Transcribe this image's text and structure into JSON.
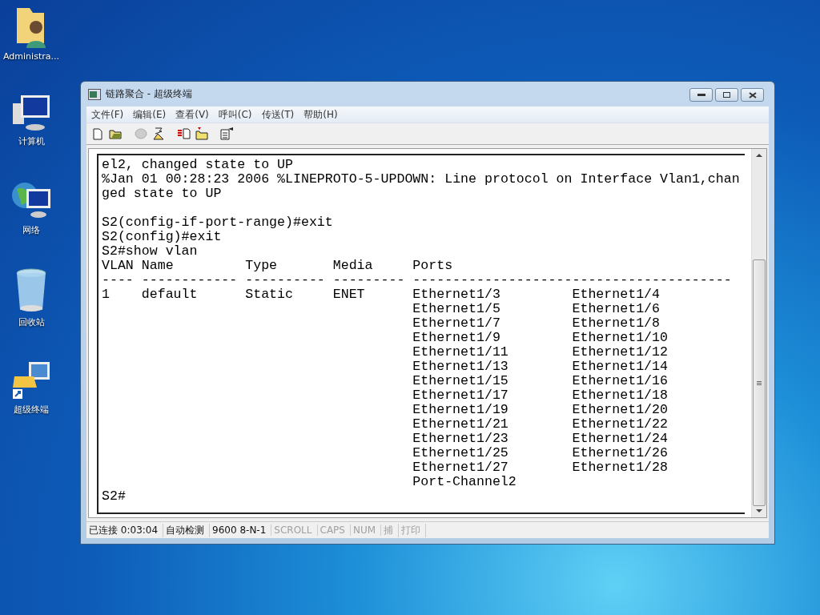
{
  "desktop_icons": [
    {
      "kind": "user-folder",
      "label": "Administra..."
    },
    {
      "kind": "computer",
      "label": "计算机"
    },
    {
      "kind": "network",
      "label": "网络"
    },
    {
      "kind": "recycle-bin",
      "label": "回收站"
    },
    {
      "kind": "terminal-shortcut",
      "label": "超级终端"
    }
  ],
  "window": {
    "title": "链路聚合 - 超级终端"
  },
  "menu": [
    "文件(F)",
    "编辑(E)",
    "查看(V)",
    "呼叫(C)",
    "传送(T)",
    "帮助(H)"
  ],
  "toolbar": [
    [
      {
        "kind": "new",
        "disabled": false
      },
      {
        "kind": "open",
        "disabled": false
      }
    ],
    [
      {
        "kind": "dial",
        "disabled": true
      },
      {
        "kind": "disconnect",
        "disabled": false
      }
    ],
    [
      {
        "kind": "send",
        "disabled": false
      },
      {
        "kind": "receive",
        "disabled": false
      }
    ],
    [
      {
        "kind": "properties",
        "disabled": false
      }
    ]
  ],
  "terminal": {
    "output_blocks": [
      [
        "el2, changed state to UP",
        "%Jan 01 00:28:23 2006 %LINEPROTO-5-UPDOWN: Line protocol on Interface Vlan1,chan",
        "ged state to UP"
      ],
      [
        "S2(config-if-port-range)#exit",
        "S2(config)#exit",
        "S2#show vlan"
      ]
    ],
    "vlan_table": {
      "columns": [
        "VLAN",
        "Name",
        "Type",
        "Media",
        "Ports"
      ],
      "separators": [
        "----",
        "------------",
        "----------",
        "---------",
        "----------------------------------------"
      ],
      "rows": [
        {
          "vlan": "1",
          "name": "default",
          "type": "Static",
          "media": "ENET",
          "ports": [
            "Ethernet1/3",
            "Ethernet1/4",
            "Ethernet1/5",
            "Ethernet1/6",
            "Ethernet1/7",
            "Ethernet1/8",
            "Ethernet1/9",
            "Ethernet1/10",
            "Ethernet1/11",
            "Ethernet1/12",
            "Ethernet1/13",
            "Ethernet1/14",
            "Ethernet1/15",
            "Ethernet1/16",
            "Ethernet1/17",
            "Ethernet1/18",
            "Ethernet1/19",
            "Ethernet1/20",
            "Ethernet1/21",
            "Ethernet1/22",
            "Ethernet1/23",
            "Ethernet1/24",
            "Ethernet1/25",
            "Ethernet1/26",
            "Ethernet1/27",
            "Ethernet1/28",
            "Port-Channel2"
          ]
        }
      ]
    },
    "prompt": "S2#"
  },
  "status_bar": [
    {
      "text": "已连接 0:03:04",
      "disabled": false
    },
    {
      "text": "自动检测",
      "disabled": false
    },
    {
      "text": "9600 8-N-1",
      "disabled": false
    },
    {
      "text": "SCROLL",
      "disabled": true
    },
    {
      "text": "CAPS",
      "disabled": true
    },
    {
      "text": "NUM",
      "disabled": true
    },
    {
      "text": "捕",
      "disabled": true
    },
    {
      "text": "打印",
      "disabled": true
    }
  ]
}
